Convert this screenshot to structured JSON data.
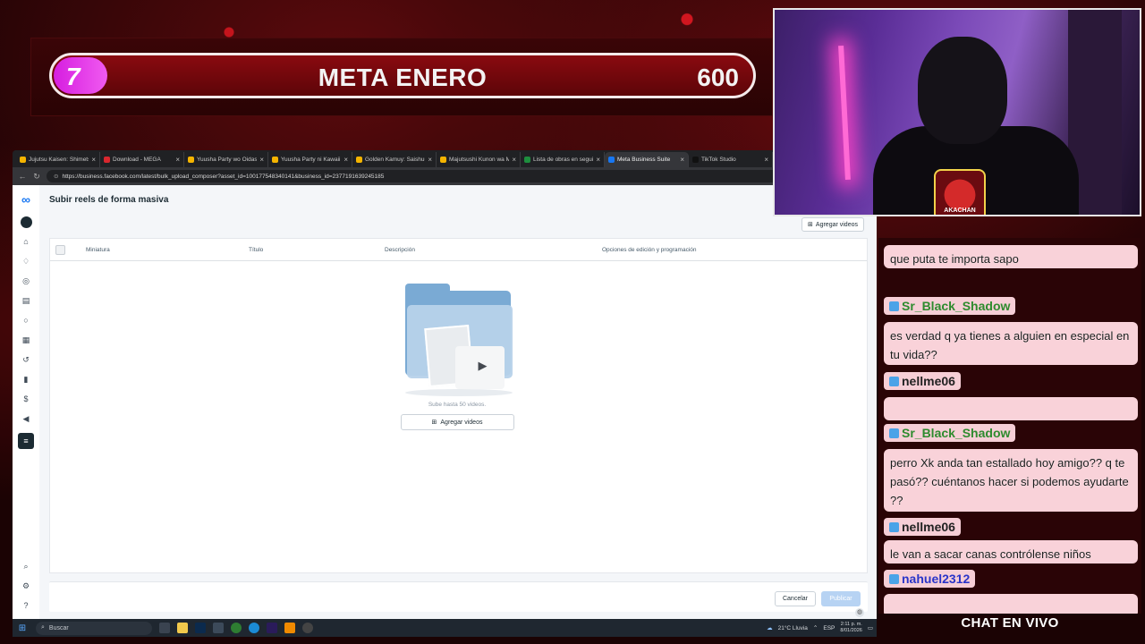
{
  "goal": {
    "current": "7",
    "title": "META ENERO",
    "target": "600",
    "progress_fraction": 0.012
  },
  "browser": {
    "tabs": [
      {
        "label": "Jujutsu Kaisen: Shimetsu",
        "color": "#f5b400",
        "active": false
      },
      {
        "label": "Download - MEGA",
        "color": "#d9272e",
        "active": false
      },
      {
        "label": "Yuusha Party wo Oidas",
        "color": "#f5b400",
        "active": false
      },
      {
        "label": "Yuusha Party ni Kawaii",
        "color": "#f5b400",
        "active": false
      },
      {
        "label": "Golden Kamuy: Saishuu",
        "color": "#f5b400",
        "active": false
      },
      {
        "label": "Majutsushi Kunon wa M",
        "color": "#f5b400",
        "active": false
      },
      {
        "label": "Lista de obras en segui",
        "color": "#1e8e3e",
        "active": false
      },
      {
        "label": "Meta Business Suite",
        "color": "#1877f2",
        "active": true
      },
      {
        "label": "TikTok Studio",
        "color": "#111111",
        "active": false
      }
    ],
    "url": "https://business.facebook.com/latest/bulk_upload_composer?asset_id=100177548340141&business_id=2377191639245185"
  },
  "page": {
    "title": "Subir reels de forma masiva",
    "add_videos_top": "Agregar videos",
    "columns": [
      "Miniatura",
      "Título",
      "Descripción",
      "Opciones de edición y programación"
    ],
    "empty_hint": "Sube hasta 50 videos.",
    "add_videos_button": "Agregar videos",
    "cancel": "Cancelar",
    "publish": "Publicar"
  },
  "taskbar": {
    "search_placeholder": "Buscar",
    "weather": "21°C Lluvia",
    "lang": "ESP",
    "time": "2:11 p. m.",
    "date": "8/01/2026"
  },
  "cam": {
    "logo_text": "AKACHAN"
  },
  "chat": {
    "title": "CHAT EN VIVO",
    "entries": [
      {
        "type": "msg",
        "text": "que puta te importa sapo"
      },
      {
        "type": "user",
        "name": "Sr_Black_Shadow",
        "color": "#2e8b2e"
      },
      {
        "type": "msg",
        "text": "es verdad q ya tienes a alguien en especial en tu vida??"
      },
      {
        "type": "user",
        "name": "nellme06",
        "color": "#222222"
      },
      {
        "type": "msg",
        "text": ""
      },
      {
        "type": "user",
        "name": "Sr_Black_Shadow",
        "color": "#2e8b2e"
      },
      {
        "type": "msg",
        "text": "perro Xk anda tan estallado hoy amigo?? q te pasó?? cuéntanos hacer si podemos ayudarte ??"
      },
      {
        "type": "user",
        "name": "nellme06",
        "color": "#222222"
      },
      {
        "type": "msg",
        "text": "le van a sacar canas contrólense niños"
      },
      {
        "type": "user",
        "name": "nahuel2312",
        "color": "#2a35c9"
      },
      {
        "type": "msg",
        "text": ""
      }
    ]
  }
}
